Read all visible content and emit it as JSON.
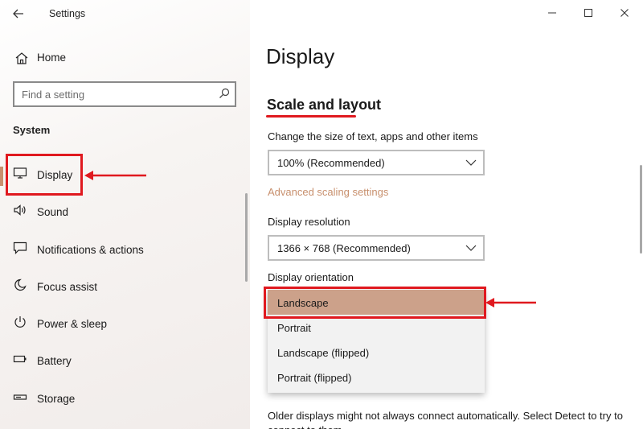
{
  "window": {
    "title": "Settings",
    "controls": {
      "minimize": "minimize-icon",
      "maximize": "maximize-icon",
      "close": "close-icon"
    }
  },
  "sidebar": {
    "back_icon": "arrow-left-icon",
    "home_label": "Home",
    "search_placeholder": "Find a setting",
    "section_title": "System",
    "items": [
      {
        "label": "Display",
        "icon": "monitor-icon",
        "selected": true
      },
      {
        "label": "Sound",
        "icon": "speaker-icon",
        "selected": false
      },
      {
        "label": "Notifications & actions",
        "icon": "message-icon",
        "selected": false
      },
      {
        "label": "Focus assist",
        "icon": "moon-icon",
        "selected": false
      },
      {
        "label": "Power & sleep",
        "icon": "power-icon",
        "selected": false
      },
      {
        "label": "Battery",
        "icon": "battery-icon",
        "selected": false
      },
      {
        "label": "Storage",
        "icon": "storage-icon",
        "selected": false
      }
    ]
  },
  "main": {
    "page_title": "Display",
    "section_title": "Scale and layout",
    "scale_label": "Change the size of text, apps and other items",
    "scale_value": "100% (Recommended)",
    "advanced_link": "Advanced scaling settings",
    "resolution_label": "Display resolution",
    "resolution_value": "1366 × 768 (Recommended)",
    "orientation_label": "Display orientation",
    "orientation_options": [
      "Landscape",
      "Portrait",
      "Landscape (flipped)",
      "Portrait (flipped)"
    ],
    "orientation_selected": "Landscape",
    "bottom_text": "Older displays might not always connect automatically. Select Detect to try to connect to them."
  },
  "colors": {
    "accent": "#c8906e",
    "selected_option": "#cca18a",
    "annotation": "#e0191f"
  }
}
